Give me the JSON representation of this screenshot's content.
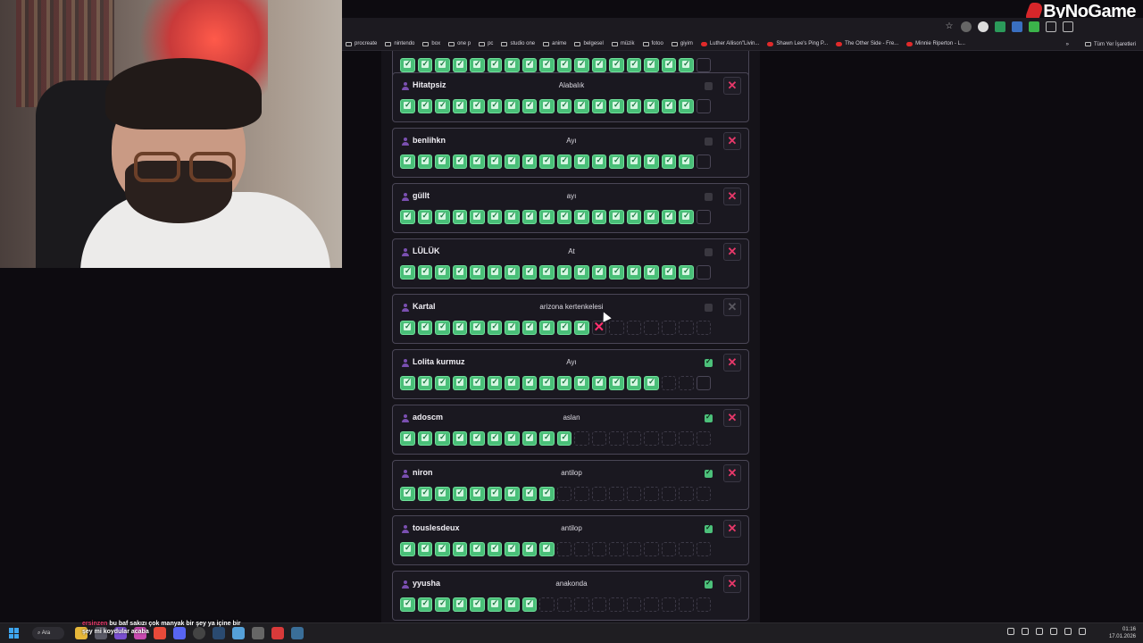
{
  "brand": {
    "logo_text": "ByNoGame"
  },
  "browser": {
    "bookmarks": [
      {
        "label": "procreate",
        "type": "folder"
      },
      {
        "label": "nintendo",
        "type": "folder"
      },
      {
        "label": "box",
        "type": "folder"
      },
      {
        "label": "one p",
        "type": "folder"
      },
      {
        "label": "pc",
        "type": "folder"
      },
      {
        "label": "studio one",
        "type": "folder"
      },
      {
        "label": "anime",
        "type": "folder"
      },
      {
        "label": "belgesel",
        "type": "folder"
      },
      {
        "label": "müzik",
        "type": "folder"
      },
      {
        "label": "fotoo",
        "type": "folder"
      },
      {
        "label": "giyim",
        "type": "folder"
      },
      {
        "label": "Luther Allison\"Livin...",
        "type": "youtube"
      },
      {
        "label": "Shawn Lee's Ping P...",
        "type": "youtube"
      },
      {
        "label": "The Other Side - Fre...",
        "type": "youtube"
      },
      {
        "label": "Minnie Riperton - L...",
        "type": "youtube"
      }
    ],
    "more_label": "»",
    "all_bookmarks": "Tüm Yer İşaretleri"
  },
  "players": [
    {
      "name": "Hitatpsiz",
      "animal": "Alabalık",
      "checked": false,
      "checked_color": "grey",
      "delete_active": true,
      "ok": 17,
      "bad": false,
      "empty": 0,
      "last_slot": true
    },
    {
      "name": "benlihkn",
      "animal": "Ayı",
      "checked": false,
      "delete_active": true,
      "ok": 17,
      "bad": false,
      "empty": 0,
      "last_slot": true
    },
    {
      "name": "güllt",
      "animal": "ayı",
      "checked": false,
      "delete_active": true,
      "ok": 17,
      "bad": false,
      "empty": 0,
      "last_slot": true
    },
    {
      "name": "LÜLÜK",
      "animal": "At",
      "checked": false,
      "delete_active": true,
      "ok": 17,
      "bad": false,
      "empty": 0,
      "last_slot": true
    },
    {
      "name": "Kartal",
      "animal": "arizona kertenkelesi",
      "checked": false,
      "delete_active": false,
      "ok": 11,
      "bad": true,
      "empty": 6,
      "last_slot": false
    },
    {
      "name": "Lolita kurmuz",
      "animal": "Ayı",
      "checked": true,
      "delete_active": true,
      "ok": 15,
      "bad": false,
      "empty": 2,
      "last_slot": true
    },
    {
      "name": "adoscm",
      "animal": "aslan",
      "checked": true,
      "delete_active": true,
      "ok": 10,
      "bad": false,
      "empty": 8,
      "last_slot": false
    },
    {
      "name": "niron",
      "animal": "antilop",
      "checked": true,
      "delete_active": true,
      "ok": 9,
      "bad": false,
      "empty": 9,
      "last_slot": false
    },
    {
      "name": "touslesdeux",
      "animal": "antilop",
      "checked": true,
      "delete_active": true,
      "ok": 9,
      "bad": false,
      "empty": 9,
      "last_slot": false
    },
    {
      "name": "yyusha",
      "animal": "anakonda",
      "checked": true,
      "delete_active": true,
      "ok": 8,
      "bad": false,
      "empty": 10,
      "last_slot": false
    }
  ],
  "delete_symbol": "✕",
  "bad_symbol": "✕",
  "chat": {
    "user": "ersinzen",
    "line1": "bu baf sakızı çok manyak bir şey ya içine bir",
    "line2": "şey mi koydular acaba"
  },
  "taskbar": {
    "search_label": "Ara",
    "time": "01:16",
    "date": "17.01.2026"
  }
}
